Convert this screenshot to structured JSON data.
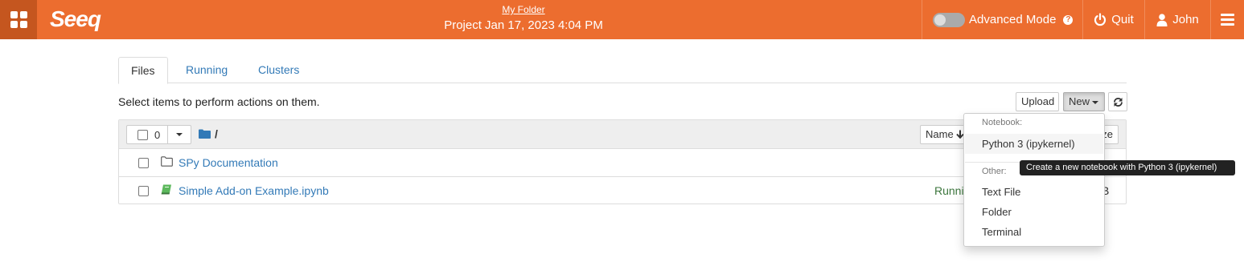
{
  "topbar": {
    "logo": "Seeq",
    "folder_link": "My Folder",
    "project_title": "Project Jan 17, 2023 4:04 PM",
    "advanced_mode_label": "Advanced Mode",
    "advanced_mode_on": false,
    "help_glyph": "?",
    "quit_label": "Quit",
    "user_label": "John",
    "accent_color": "#ec6d2f"
  },
  "tabs": [
    {
      "label": "Files",
      "active": true
    },
    {
      "label": "Running",
      "active": false
    },
    {
      "label": "Clusters",
      "active": false
    }
  ],
  "toolbar": {
    "select_message": "Select items to perform actions on them.",
    "upload_label": "Upload",
    "new_label": "New"
  },
  "listing": {
    "selected_count": "0",
    "breadcrumb": "/",
    "name_sort_label": "Name",
    "size_sort_label": "ze",
    "rows": [
      {
        "name": "SPy Documentation",
        "type": "folder",
        "status": "",
        "size": ""
      },
      {
        "name": "Simple Add-on Example.ipynb",
        "type": "notebook",
        "status": "Runni",
        "size": "kB"
      }
    ]
  },
  "new_menu": {
    "notebook_header": "Notebook:",
    "notebook_items": [
      "Python 3 (ipykernel)"
    ],
    "other_header": "Other:",
    "other_items": [
      "Text File",
      "Folder",
      "Terminal"
    ]
  },
  "tooltip": "Create a new notebook with Python 3 (ipykernel)"
}
